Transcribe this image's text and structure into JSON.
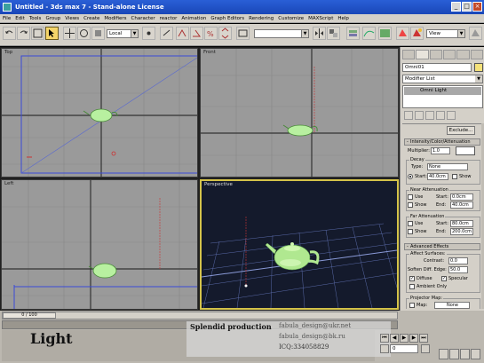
{
  "window": {
    "title": "Untitled - 3ds max 7 - Stand-alone License",
    "minimize": "_",
    "maximize": "□",
    "close": "×"
  },
  "menu": [
    "File",
    "Edit",
    "Tools",
    "Group",
    "Views",
    "Create",
    "Modifiers",
    "Character",
    "reactor",
    "Animation",
    "Graph Editors",
    "Rendering",
    "Customize",
    "MAXScript",
    "Help"
  ],
  "toolbar": {
    "coord_system": "Local",
    "named_selection": "",
    "view_dropdown": "View"
  },
  "viewports": {
    "top": "Top",
    "front": "Front",
    "left": "Left",
    "perspective": "Perspective"
  },
  "command_panel": {
    "object_name": "Omni01",
    "modifier_list": "Modifier List",
    "stack_item": "Omni Light",
    "exclude_button": "Exclude...",
    "rollouts": {
      "intensity": "Intensity/Color/Attenuation",
      "multiplier_label": "Multiplier:",
      "multiplier_value": "1.0",
      "decay_group": "Decay",
      "decay_type_label": "Type:",
      "decay_type_value": "None",
      "decay_start_label": "Start:",
      "decay_start_value": "40.0cm",
      "decay_show": "Show",
      "near_atten_group": "Near Attenuation",
      "near_use": "Use",
      "near_show": "Show",
      "near_start_label": "Start:",
      "near_start_value": "0.0cm",
      "near_end_label": "End:",
      "near_end_value": "40.0cm",
      "far_atten_group": "Far Attenuation",
      "far_use": "Use",
      "far_show": "Show",
      "far_start_label": "Start:",
      "far_start_value": "80.0cm",
      "far_end_label": "End:",
      "far_end_value": "200.0cm",
      "advanced": "Advanced Effects",
      "affect_surfaces_group": "Affect Surfaces:",
      "contrast_label": "Contrast:",
      "contrast_value": "0.0",
      "soften_label": "Soften Diff. Edge:",
      "soften_value": "50.0",
      "diffuse_label": "Diffuse",
      "specular_label": "Specular",
      "ambient_label": "Ambient Only",
      "projector_group": "Projector Map:",
      "map_label": "Map:",
      "map_value": "None"
    }
  },
  "trackbar": {
    "frame": "0 / 100"
  },
  "overlay": {
    "title": "Light",
    "credit_line1": "Splendid production",
    "credit_line2": "fabula_design@ukr.net",
    "credit_line3": "fabula_design@bk.ru",
    "credit_line4": "ICQ:334058829"
  },
  "playback": {
    "frame_value": "0"
  }
}
